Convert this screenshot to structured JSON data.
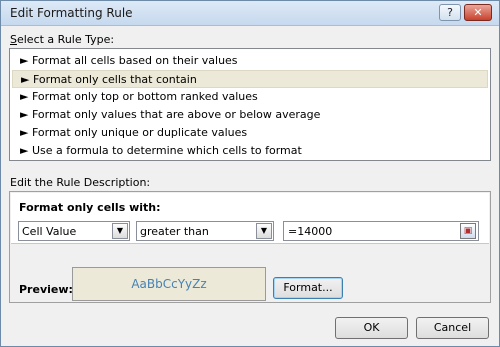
{
  "window": {
    "title": "Edit Formatting Rule",
    "help_glyph": "?",
    "close_glyph": "✕"
  },
  "rule_type": {
    "label": "Select a Rule Type:",
    "bullet": "►",
    "items": [
      {
        "label": "Format all cells based on their values",
        "selected": false
      },
      {
        "label": "Format only cells that contain",
        "selected": true
      },
      {
        "label": "Format only top or bottom ranked values",
        "selected": false
      },
      {
        "label": "Format only values that are above or below average",
        "selected": false
      },
      {
        "label": "Format only unique or duplicate values",
        "selected": false
      },
      {
        "label": "Use a formula to determine which cells to format",
        "selected": false
      }
    ]
  },
  "description": {
    "label": "Edit the Rule Description:",
    "heading": "Format only cells with:",
    "condition_type": "Cell Value",
    "operator": "greater than",
    "value": "=14000",
    "preview_label": "Preview:",
    "preview_sample": "AaBbCcYyZz",
    "format_button": "Format..."
  },
  "buttons": {
    "ok": "OK",
    "cancel": "Cancel"
  },
  "colors": {
    "preview_background": "#ece9d8",
    "preview_text": "#4682b4",
    "selected_row": "#ece9d8"
  }
}
